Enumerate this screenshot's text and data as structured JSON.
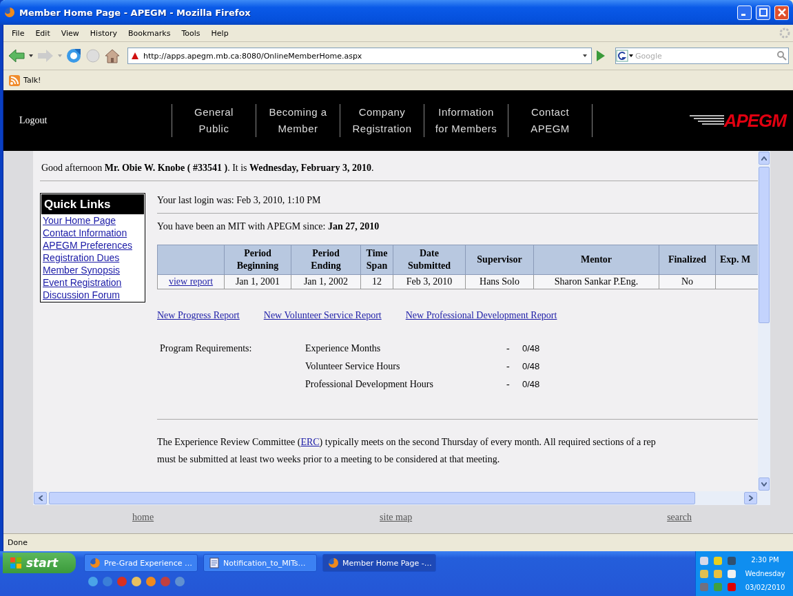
{
  "window": {
    "title": "Member Home Page - APEGM - Mozilla Firefox"
  },
  "menu": [
    "File",
    "Edit",
    "View",
    "History",
    "Bookmarks",
    "Tools",
    "Help"
  ],
  "address_bar": {
    "url": "http://apps.apegm.mb.ca:8080/OnlineMemberHome.aspx"
  },
  "search_bar": {
    "placeholder": "Google"
  },
  "bookmarks": [
    "Talk!"
  ],
  "site_header": {
    "logout": "Logout",
    "logo": "APEGM",
    "nav": [
      {
        "lines": [
          "General",
          "Public"
        ]
      },
      {
        "lines": [
          "Becoming a",
          "Member"
        ]
      },
      {
        "lines": [
          "Company",
          "Registration"
        ]
      },
      {
        "lines": [
          "Information",
          "for Members"
        ]
      },
      {
        "lines": [
          "Contact",
          "APEGM"
        ]
      }
    ]
  },
  "greeting": "Good afternoon **Mr. Obie W. Knobe ( #33541 )**. It is **Wednesday, February 3, 2010**.",
  "quick_links": {
    "title": "Quick Links",
    "items": [
      "Your Home Page",
      "Contact Information",
      "APEGM Preferences",
      "Registration Dues",
      "Member Synopsis",
      "Event Registration",
      "Discussion Forum"
    ]
  },
  "last_login": "Your last login was: Feb 3, 2010, 1:10 PM",
  "member_since": "You have been an MIT with APEGM since: **Jan 27, 2010**",
  "reports_table": {
    "columns": [
      {
        "lines": [
          "Period",
          "Beginning"
        ]
      },
      {
        "lines": [
          "Period",
          "Ending"
        ]
      },
      {
        "lines": [
          "Time",
          "Span"
        ]
      },
      {
        "lines": [
          "Date",
          "Submitted"
        ]
      },
      {
        "lines": [
          "Supervisor"
        ]
      },
      {
        "lines": [
          "Mentor"
        ]
      },
      {
        "lines": [
          "Finalized"
        ]
      },
      {
        "lines": [
          "Exp. M"
        ]
      }
    ],
    "rows": [
      {
        "link": "view report",
        "cells": [
          "Jan 1, 2001",
          "Jan 1, 2002",
          "12",
          "Feb 3, 2010",
          "Hans Solo",
          "Sharon Sankar P.Eng.",
          "No"
        ]
      }
    ]
  },
  "report_links": [
    "New Progress Report",
    "New Volunteer Service Report",
    "New Professional Development Report"
  ],
  "requirements": {
    "label": "Program Requirements:",
    "items": [
      {
        "name": "Experience Months",
        "dash": "-",
        "value": "0/48"
      },
      {
        "name": "Volunteer Service Hours",
        "dash": "-",
        "value": "0/48"
      },
      {
        "name": "Professional Development Hours",
        "dash": "-",
        "value": "0/48"
      }
    ]
  },
  "erc_note": {
    "before": "The Experience Review Committee (",
    "link": "ERC",
    "after": ") typically meets on the second Thursday of every month. All required sections of a rep",
    "continuation": "must be submitted at least two weeks prior to a meeting to be considered at that meeting."
  },
  "footer_links": [
    "home",
    "site map",
    "search"
  ],
  "status_bar": "Done",
  "taskbar": {
    "start": "start",
    "tasks": [
      {
        "label": "Pre-Grad Experience …",
        "kind": "browser",
        "selected": false
      },
      {
        "label": "Notification_to_MITs…",
        "kind": "document",
        "selected": false
      },
      {
        "label": "Member Home Page -…",
        "kind": "browser",
        "selected": true
      }
    ],
    "clock": [
      "2:30 PM",
      "Wednesday",
      "03/02/2010"
    ]
  }
}
